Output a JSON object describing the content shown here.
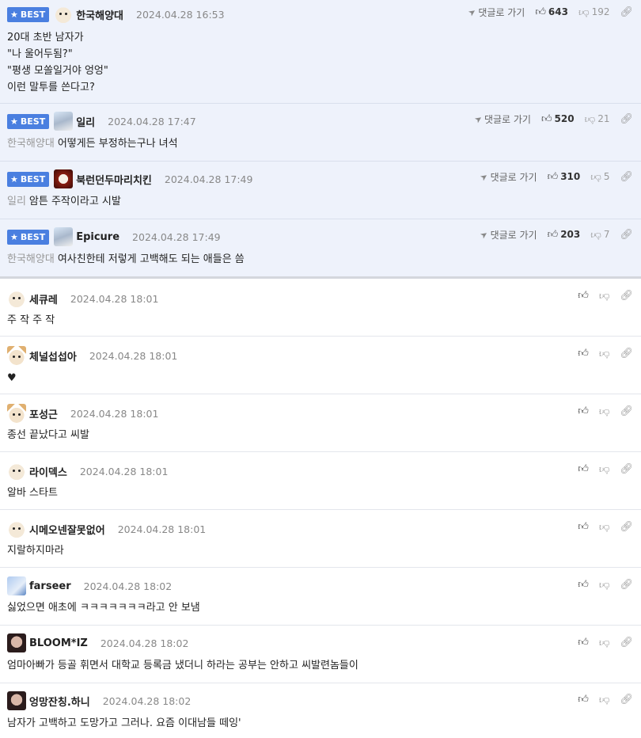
{
  "labels": {
    "best": "BEST",
    "goto": "댓글로 가기"
  },
  "best_comments": [
    {
      "nick": "한국해양대",
      "date": "2024.04.28 16:53",
      "up": "643",
      "down": "192",
      "lines": [
        "20대 초반 남자가",
        "\"나 울어두됨?\"",
        "\"평생 모쏠일거야 엉엉\"",
        "이런 말투를 쓴다고?"
      ],
      "reply_to": ""
    },
    {
      "nick": "일리",
      "date": "2024.04.28 17:47",
      "up": "520",
      "down": "21",
      "lines": [
        "어떻게든 부정하는구나 녀석"
      ],
      "reply_to": "한국해양대"
    },
    {
      "nick": "북런던두마리치킨",
      "date": "2024.04.28 17:49",
      "up": "310",
      "down": "5",
      "lines": [
        "암튼 주작이라고 시발"
      ],
      "reply_to": "일리"
    },
    {
      "nick": "Epicure",
      "date": "2024.04.28 17:49",
      "up": "203",
      "down": "7",
      "lines": [
        "여사친한테 저렇게 고백해도 되는 애들은 씀"
      ],
      "reply_to": "한국해양대"
    }
  ],
  "comments": [
    {
      "nick": "세큐레",
      "date": "2024.04.28 18:01",
      "text": "주 작 주 작"
    },
    {
      "nick": "체널섭섭아",
      "date": "2024.04.28 18:01",
      "text": "♥"
    },
    {
      "nick": "포성근",
      "date": "2024.04.28 18:01",
      "text": "종선 끝났다고 씨발"
    },
    {
      "nick": "라이덱스",
      "date": "2024.04.28 18:01",
      "text": "알바 스타트"
    },
    {
      "nick": "시메오넨잘못없어",
      "date": "2024.04.28 18:01",
      "text": "지랄하지마라"
    },
    {
      "nick": "farseer",
      "date": "2024.04.28 18:02",
      "text": "싫었으면 애초에 ㅋㅋㅋㅋㅋㅋㅋ라고 안 보냄"
    },
    {
      "nick": "BLOOM*IZ",
      "date": "2024.04.28 18:02",
      "text": "엄마아빠가 등골 휘면서 대학교 등록금 냈더니 하라는 공부는 안하고 씨발련놈들이"
    },
    {
      "nick": "엉망잔칭.하니",
      "date": "2024.04.28 18:02",
      "text": "남자가 고백하고 도망가고 그러나. 요즘 이대남들 떼잉'"
    }
  ],
  "icons": {
    "goto": "send-arrow-icon",
    "up": "thumbs-up-icon",
    "down": "thumbs-down-icon",
    "link": "link-icon"
  },
  "colors": {
    "best_bg": "#eef2fb",
    "badge": "#4a7fe0"
  }
}
